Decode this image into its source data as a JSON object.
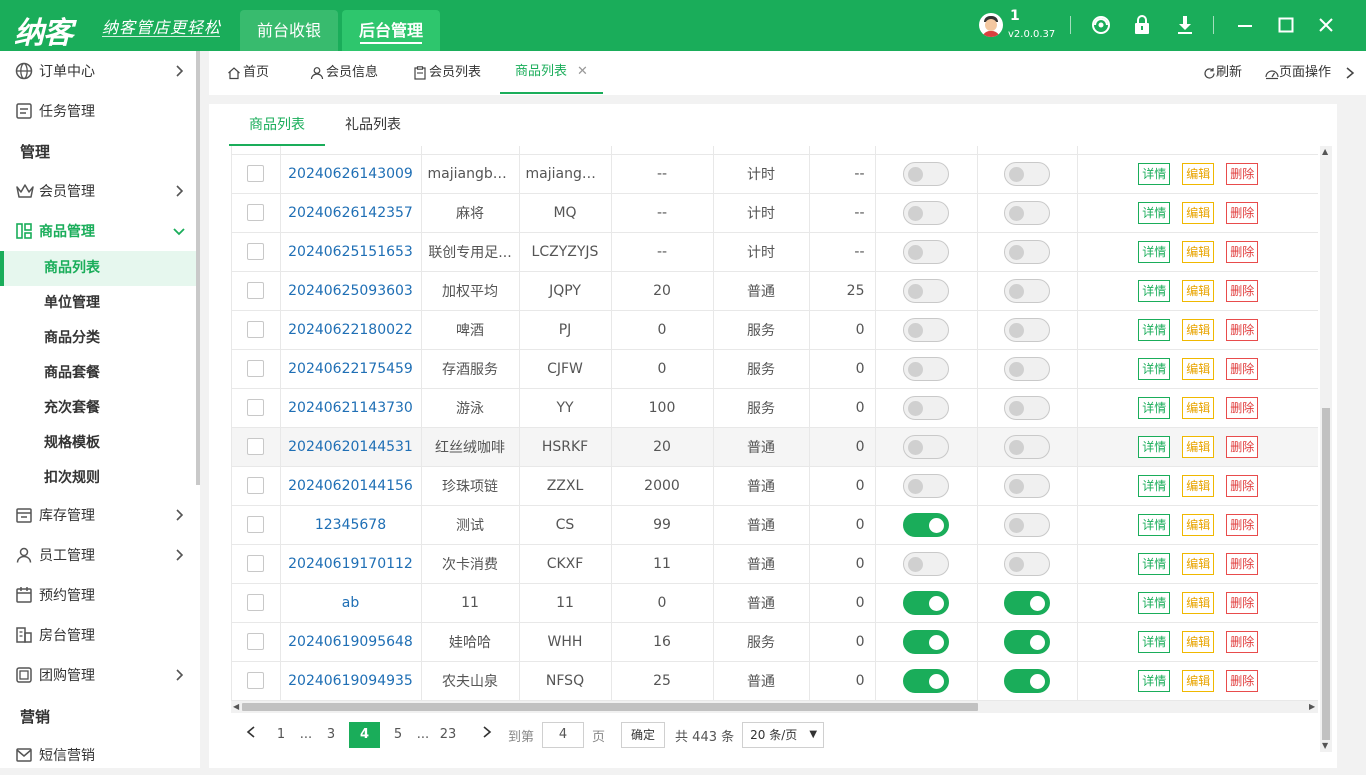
{
  "app": {
    "logo": "纳客",
    "slogan": "纳客管店更轻松",
    "top_tabs": [
      "前台收银",
      "后台管理"
    ],
    "active_top_tab": 1,
    "user": "1",
    "version": "v2.0.0.37"
  },
  "sidebar": {
    "items": [
      {
        "label": "订单中心",
        "icon": "order-center-icon",
        "chevron": true
      },
      {
        "label": "任务管理",
        "icon": "task-icon",
        "chevron": false
      }
    ],
    "group1": "管理",
    "items2": [
      {
        "label": "会员管理",
        "icon": "crown-icon",
        "chevron": true
      },
      {
        "label": "商品管理",
        "icon": "goods-icon",
        "chevron": true,
        "open": true
      }
    ],
    "sub_items": [
      "商品列表",
      "单位管理",
      "商品分类",
      "商品套餐",
      "充次套餐",
      "规格模板",
      "扣次规则"
    ],
    "active_sub": 0,
    "items3": [
      {
        "label": "库存管理",
        "icon": "inventory-icon",
        "chevron": true
      },
      {
        "label": "员工管理",
        "icon": "staff-icon",
        "chevron": true
      },
      {
        "label": "预约管理",
        "icon": "calendar-icon",
        "chevron": false
      },
      {
        "label": "房台管理",
        "icon": "room-icon",
        "chevron": false
      },
      {
        "label": "团购管理",
        "icon": "groupbuy-icon",
        "chevron": true
      }
    ],
    "group2": "营销",
    "items4": [
      {
        "label": "短信营销",
        "icon": "sms-icon",
        "chevron": false
      }
    ]
  },
  "page_tabs": [
    {
      "label": "首页",
      "icon": "home-icon"
    },
    {
      "label": "会员信息",
      "icon": "user-icon"
    },
    {
      "label": "会员列表",
      "icon": "clipboard-icon"
    },
    {
      "label": "商品列表",
      "icon": "",
      "active": true,
      "closable": true
    }
  ],
  "page_ops": {
    "refresh": "刷新",
    "page_ops": "页面操作"
  },
  "sub_tabs": [
    "商品列表",
    "礼品列表"
  ],
  "table": {
    "rows": [
      {
        "code": "20240626143009",
        "name": "majiangba...",
        "short": "majiangba...",
        "price": "--",
        "type": "计时",
        "val": "--",
        "s1": false,
        "s2": false
      },
      {
        "code": "20240626142357",
        "name": "麻将",
        "short": "MQ",
        "price": "--",
        "type": "计时",
        "val": "--",
        "s1": false,
        "s2": false
      },
      {
        "code": "20240625151653",
        "name": "联创专用足...",
        "short": "LCZYZYJS",
        "price": "--",
        "type": "计时",
        "val": "--",
        "s1": false,
        "s2": false
      },
      {
        "code": "20240625093603",
        "name": "加权平均",
        "short": "JQPY",
        "price": "20",
        "type": "普通",
        "val": "25",
        "s1": false,
        "s2": false
      },
      {
        "code": "20240622180022",
        "name": "啤酒",
        "short": "PJ",
        "price": "0",
        "type": "服务",
        "val": "0",
        "s1": false,
        "s2": false
      },
      {
        "code": "20240622175459",
        "name": "存酒服务",
        "short": "CJFW",
        "price": "0",
        "type": "服务",
        "val": "0",
        "s1": false,
        "s2": false
      },
      {
        "code": "20240621143730",
        "name": "游泳",
        "short": "YY",
        "price": "100",
        "type": "服务",
        "val": "0",
        "s1": false,
        "s2": false
      },
      {
        "code": "20240620144531",
        "name": "红丝绒咖啡",
        "short": "HSRKF",
        "price": "20",
        "type": "普通",
        "val": "0",
        "s1": false,
        "s2": false,
        "highlight": true
      },
      {
        "code": "20240620144156",
        "name": "珍珠项链",
        "short": "ZZXL",
        "price": "2000",
        "type": "普通",
        "val": "0",
        "s1": false,
        "s2": false
      },
      {
        "code": "12345678",
        "name": "测试",
        "short": "CS",
        "price": "99",
        "type": "普通",
        "val": "0",
        "s1": true,
        "s2": false
      },
      {
        "code": "20240619170112",
        "name": "次卡消费",
        "short": "CKXF",
        "price": "11",
        "type": "普通",
        "val": "0",
        "s1": false,
        "s2": false
      },
      {
        "code": "ab",
        "name": "11",
        "short": "11",
        "price": "0",
        "type": "普通",
        "val": "0",
        "s1": true,
        "s2": true
      },
      {
        "code": "20240619095648",
        "name": "娃哈哈",
        "short": "WHH",
        "price": "16",
        "type": "服务",
        "val": "0",
        "s1": true,
        "s2": true
      },
      {
        "code": "20240619094935",
        "name": "农夫山泉",
        "short": "NFSQ",
        "price": "25",
        "type": "普通",
        "val": "0",
        "s1": true,
        "s2": true
      }
    ],
    "actions": {
      "detail": "详情",
      "edit": "编辑",
      "delete": "删除"
    }
  },
  "pager": {
    "pages": [
      "1",
      "...",
      "3",
      "4",
      "5",
      "...",
      "23"
    ],
    "current": "4",
    "goto_label": "到第",
    "goto_value": "4",
    "page_unit": "页",
    "confirm": "确定",
    "total": "共 443 条",
    "page_size": "20 条/页"
  },
  "colors": {
    "brand": "#1aad5a",
    "link": "#1f6fb5",
    "edit": "#e8a400",
    "delete": "#e03b3b"
  }
}
